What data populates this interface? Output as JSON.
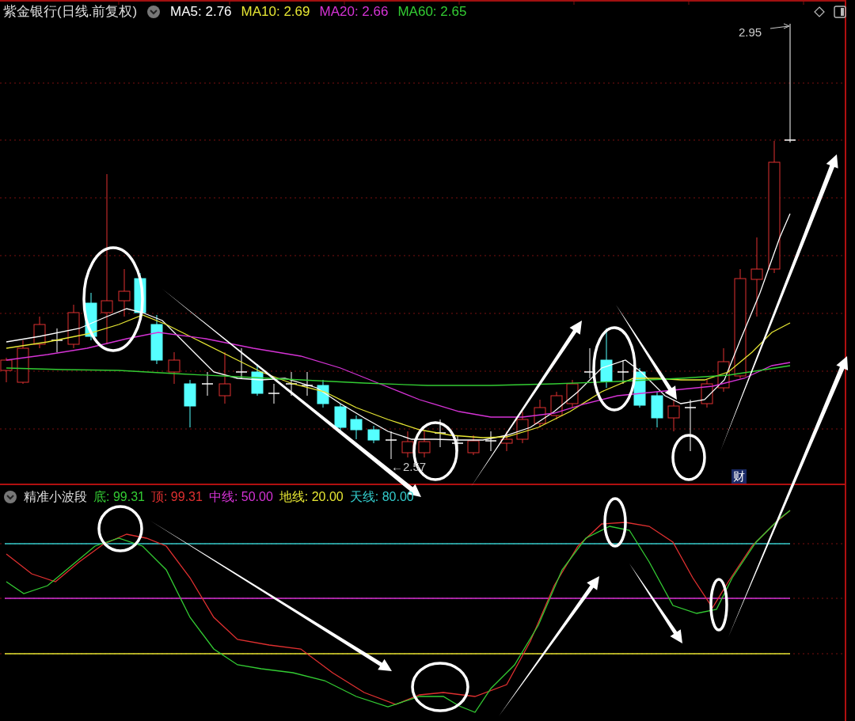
{
  "main_pane": {
    "title": "紫金银行(日线.前复权)",
    "indicators": [
      {
        "label": "MA5: 2.76",
        "color": "#ffffff"
      },
      {
        "label": "MA10: 2.69",
        "color": "#e6e633"
      },
      {
        "label": "MA20: 2.66",
        "color": "#d633d6"
      },
      {
        "label": "MA60: 2.65",
        "color": "#33cc33"
      }
    ],
    "high_label": "2.95",
    "low_label": "←2.57",
    "badge": "财"
  },
  "sub_pane": {
    "title": "精准小波段",
    "indicators": [
      {
        "label": "底: 99.31",
        "color": "#33cc33"
      },
      {
        "label": "顶: 99.31",
        "color": "#e03030"
      },
      {
        "label": "中线: 50.00",
        "color": "#d633d6"
      },
      {
        "label": "地线: 20.00",
        "color": "#e6e633"
      },
      {
        "label": "天线: 80.00",
        "color": "#33cccc"
      }
    ]
  }
}
